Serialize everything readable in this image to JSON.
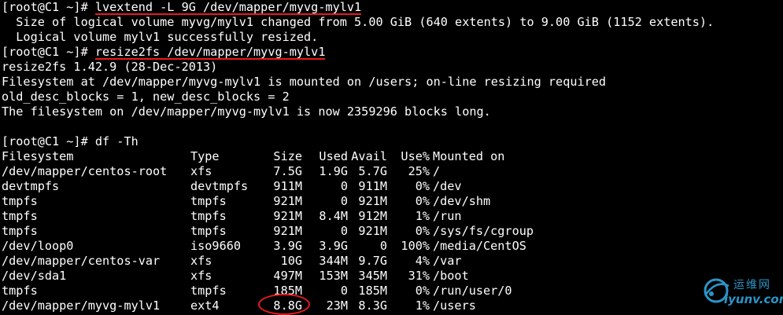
{
  "prompt": "[root@C1 ~]# ",
  "commands": {
    "lvextend": "lvextend -L 9G /dev/mapper/myvg-mylv1",
    "resize2fs": "resize2fs /dev/mapper/myvg-mylv1",
    "df": "df -Th"
  },
  "output": {
    "lvextend_1": "  Size of logical volume myvg/mylv1 changed from 5.00 GiB (640 extents) to 9.00 GiB (1152 extents).",
    "lvextend_2": "  Logical volume mylv1 successfully resized.",
    "resize2fs_1": "resize2fs 1.42.9 (28-Dec-2013)",
    "resize2fs_2": "Filesystem at /dev/mapper/myvg-mylv1 is mounted on /users; on-line resizing required",
    "resize2fs_3": "old_desc_blocks = 1, new_desc_blocks = 2",
    "resize2fs_4": "The filesystem on /dev/mapper/myvg-mylv1 is now 2359296 blocks long."
  },
  "df_table": {
    "headers": [
      "Filesystem",
      "Type",
      "Size",
      "Used",
      "Avail",
      "Use%",
      "Mounted on"
    ],
    "rows": [
      [
        "/dev/mapper/centos-root",
        "xfs",
        "7.5G",
        "1.9G",
        "5.7G",
        "25%",
        "/"
      ],
      [
        "devtmpfs",
        "devtmpfs",
        "911M",
        "0",
        "911M",
        "0%",
        "/dev"
      ],
      [
        "tmpfs",
        "tmpfs",
        "921M",
        "0",
        "921M",
        "0%",
        "/dev/shm"
      ],
      [
        "tmpfs",
        "tmpfs",
        "921M",
        "8.4M",
        "912M",
        "1%",
        "/run"
      ],
      [
        "tmpfs",
        "tmpfs",
        "921M",
        "0",
        "921M",
        "0%",
        "/sys/fs/cgroup"
      ],
      [
        "/dev/loop0",
        "iso9660",
        "3.9G",
        "3.9G",
        "0",
        "100%",
        "/media/CentOS"
      ],
      [
        "/dev/mapper/centos-var",
        "xfs",
        "10G",
        "344M",
        "9.7G",
        "4%",
        "/var"
      ],
      [
        "/dev/sda1",
        "xfs",
        "497M",
        "153M",
        "345M",
        "31%",
        "/boot"
      ],
      [
        "tmpfs",
        "tmpfs",
        "185M",
        "0",
        "185M",
        "0%",
        "/run/user/0"
      ],
      [
        "/dev/mapper/myvg-mylv1",
        "ext4",
        "8.8G",
        "23M",
        "8.3G",
        "1%",
        "/users"
      ]
    ]
  },
  "watermark": {
    "cn": "运维网",
    "en": "iyunv.com"
  },
  "colors": {
    "background": "#000000",
    "text": "#ffffff",
    "annotation": "#e81b1b",
    "watermark": "#2a95c9"
  }
}
